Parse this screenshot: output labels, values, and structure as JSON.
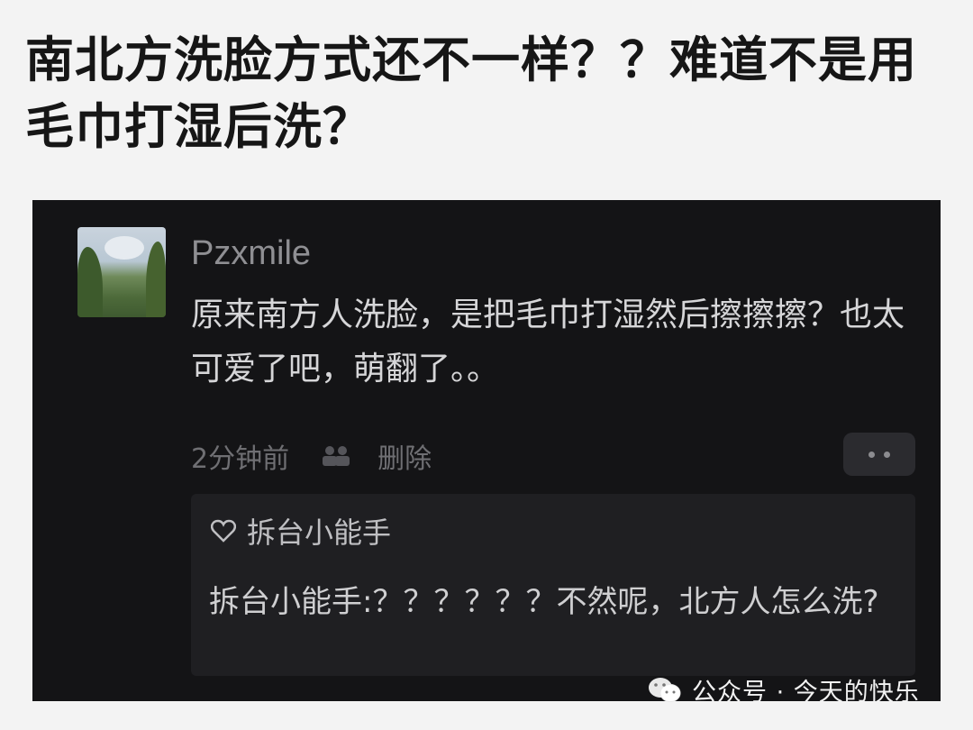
{
  "post": {
    "title": "南北方洗脸方式还不一样？？难道不是用毛巾打湿后洗？"
  },
  "comment": {
    "username": "Pzxmile",
    "text": "原来南方人洗脸，是把毛巾打湿然后擦擦擦？也太可爱了吧，萌翻了。。",
    "time": "2分钟前",
    "delete_label": "删除",
    "avatar_icon": "landscape-photo"
  },
  "reply": {
    "author": "拆台小能手",
    "text": "拆台小能手:？？？？？？不然呢，北方人怎么洗?"
  },
  "watermark": {
    "text": "公众号 · 今天的快乐",
    "icon": "wechat-icon"
  },
  "colors": {
    "page_background": "#f3f3f3",
    "screenshot_background": "#141416",
    "reply_background": "#1f1f22"
  }
}
